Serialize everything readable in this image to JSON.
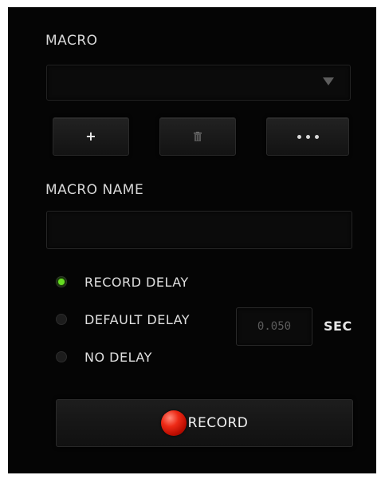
{
  "macro_section": {
    "title": "MACRO",
    "selected_macro": "",
    "dropdown_icon": "triangle-down-icon",
    "buttons": {
      "add_label": "+",
      "add_icon": "plus-icon",
      "delete_icon": "trash-icon",
      "more_icon": "ellipsis-icon"
    }
  },
  "name_section": {
    "title": "MACRO NAME",
    "name_value": ""
  },
  "delay_options": [
    {
      "label": "RECORD DELAY",
      "selected": true
    },
    {
      "label": "DEFAULT DELAY",
      "selected": false
    },
    {
      "label": "NO DELAY",
      "selected": false
    }
  ],
  "default_delay": {
    "value": "0.050",
    "unit": "SEC"
  },
  "record_button": {
    "label": "RECORD",
    "icon": "record-dot-icon"
  },
  "colors": {
    "panel_bg": "#050505",
    "text": "#e0e0e0",
    "accent_green": "#66dd22",
    "record_red": "#ee2a16"
  }
}
